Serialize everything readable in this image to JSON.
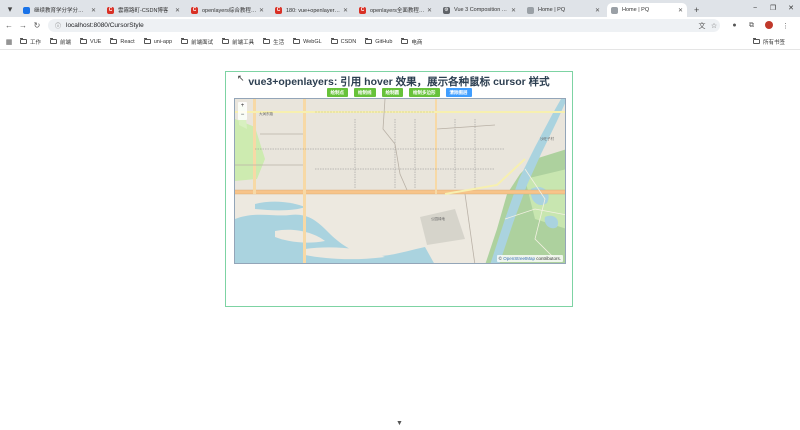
{
  "browser": {
    "tabs": [
      {
        "title": "继续教育学分学分管理系统",
        "favicon_color": "#1a73e8",
        "favicon_text": ""
      },
      {
        "title": "雲霧路町-CSDN博客",
        "favicon_color": "#d93025",
        "favicon_text": "C"
      },
      {
        "title": "openlayers综合教程300",
        "favicon_color": "#d93025",
        "favicon_text": "C"
      },
      {
        "title": "180: vue+openlayers 实",
        "favicon_color": "#d93025",
        "favicon_text": "C"
      },
      {
        "title": "openlayers全面教程300",
        "favicon_color": "#d93025",
        "favicon_text": "C"
      },
      {
        "title": "Vue 3 Composition API",
        "favicon_color": "#5f6368",
        "favicon_text": "⚙"
      },
      {
        "title": "Home | PQ",
        "favicon_color": "#9aa0a6",
        "favicon_text": ""
      },
      {
        "title": "Home | PQ",
        "favicon_color": "#9aa0a6",
        "favicon_text": "",
        "active": true
      }
    ],
    "new_tab": "+",
    "window_controls": {
      "minimize": "−",
      "maximize": "❐",
      "close": "✕"
    },
    "address": {
      "url": "localhost:8080/CursorStyle"
    },
    "bookmarks": [
      "工作",
      "前端",
      "VUE",
      "React",
      "uni-app",
      "前端面试",
      "前端工具",
      "生活",
      "WebGL",
      "CSDN",
      "GitHub",
      "电商"
    ],
    "bookmarks_right": "所有书签"
  },
  "page": {
    "title": "vue3+openlayers: 引用 hover 效果，展示各种鼠标 cursor 样式",
    "buttons": [
      {
        "label": "绘制点",
        "color": "#67c23a"
      },
      {
        "label": "绘制线",
        "color": "#67c23a"
      },
      {
        "label": "绘制圆",
        "color": "#67c23a"
      },
      {
        "label": "绘制多边形",
        "color": "#67c23a"
      },
      {
        "label": "清除图层",
        "color": "#409eff"
      }
    ],
    "map": {
      "zoom_in": "+",
      "zoom_out": "−",
      "attribution_prefix": "©",
      "attribution_link": "OpenStreetMap",
      "attribution_suffix": "contributors.",
      "labels": {
        "road": "大涧东路",
        "district": "沙旺子村",
        "area": "公园绿地"
      }
    }
  }
}
